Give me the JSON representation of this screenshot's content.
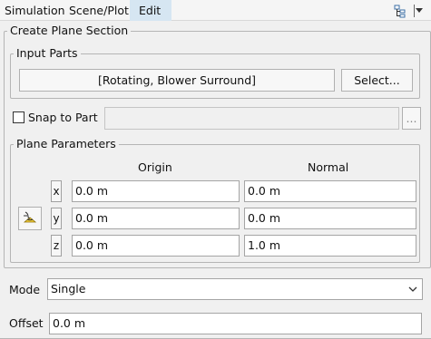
{
  "menu": {
    "items": [
      "Simulation",
      "Scene/Plot",
      "Edit"
    ],
    "active_index": 2,
    "tools": [
      "tree-icon",
      "dropdown-icon"
    ]
  },
  "panel": {
    "title": "Create Plane Section",
    "input_parts": {
      "legend": "Input Parts",
      "value": "[Rotating, Blower Surround]",
      "select_label": "Select..."
    },
    "snap": {
      "label": "Snap to Part",
      "checked": false,
      "value": "",
      "browse_label": "..."
    },
    "plane": {
      "legend": "Plane Parameters",
      "origin_header": "Origin",
      "normal_header": "Normal",
      "rows": [
        {
          "axis": "x",
          "origin": "0.0 m",
          "normal": "0.0 m"
        },
        {
          "axis": "y",
          "origin": "0.0 m",
          "normal": "0.0 m"
        },
        {
          "axis": "z",
          "origin": "0.0 m",
          "normal": "1.0 m"
        }
      ]
    },
    "mode": {
      "label": "Mode",
      "value": "Single"
    },
    "offset": {
      "label": "Offset",
      "value": "0.0 m"
    }
  },
  "colors": {
    "active_menu": "#d6e6f2",
    "background": "#f0f0f0"
  }
}
